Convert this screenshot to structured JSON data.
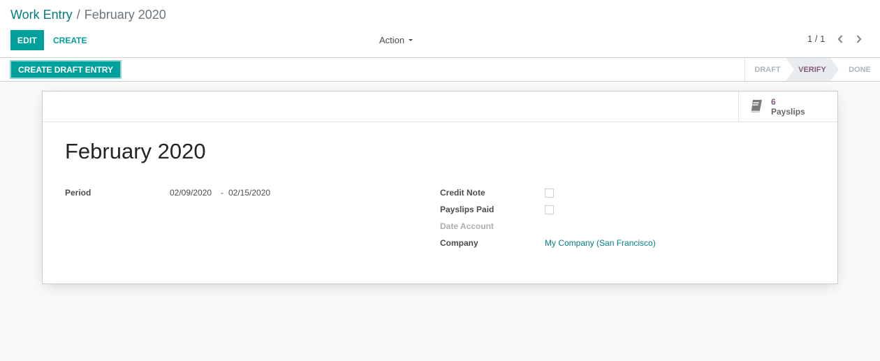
{
  "breadcrumb": {
    "parent": "Work Entry",
    "separator": "/",
    "current": "February 2020"
  },
  "toolbar": {
    "edit_label": "EDIT",
    "create_label": "CREATE",
    "action_label": "Action",
    "pager_value": "1 / 1"
  },
  "statusbar": {
    "primary_button": "CREATE DRAFT ENTRY",
    "steps": [
      {
        "label": "DRAFT",
        "active": false
      },
      {
        "label": "VERIFY",
        "active": true
      },
      {
        "label": "DONE",
        "active": false
      }
    ]
  },
  "smart_button": {
    "icon": "book-icon",
    "value": "6",
    "label": "Payslips"
  },
  "form": {
    "title": "February 2020",
    "period": {
      "label": "Period",
      "start": "02/09/2020",
      "separator": "-",
      "end": "02/15/2020"
    },
    "credit_note": {
      "label": "Credit Note",
      "checked": false
    },
    "payslips_paid": {
      "label": "Payslips Paid",
      "checked": false
    },
    "date_account": {
      "label": "Date Account",
      "value": ""
    },
    "company": {
      "label": "Company",
      "value": "My Company (San Francisco)"
    }
  },
  "colors": {
    "primary": "#00a09d",
    "link": "#017e84",
    "accent": "#875a7b",
    "background": "#f9f9f9"
  }
}
